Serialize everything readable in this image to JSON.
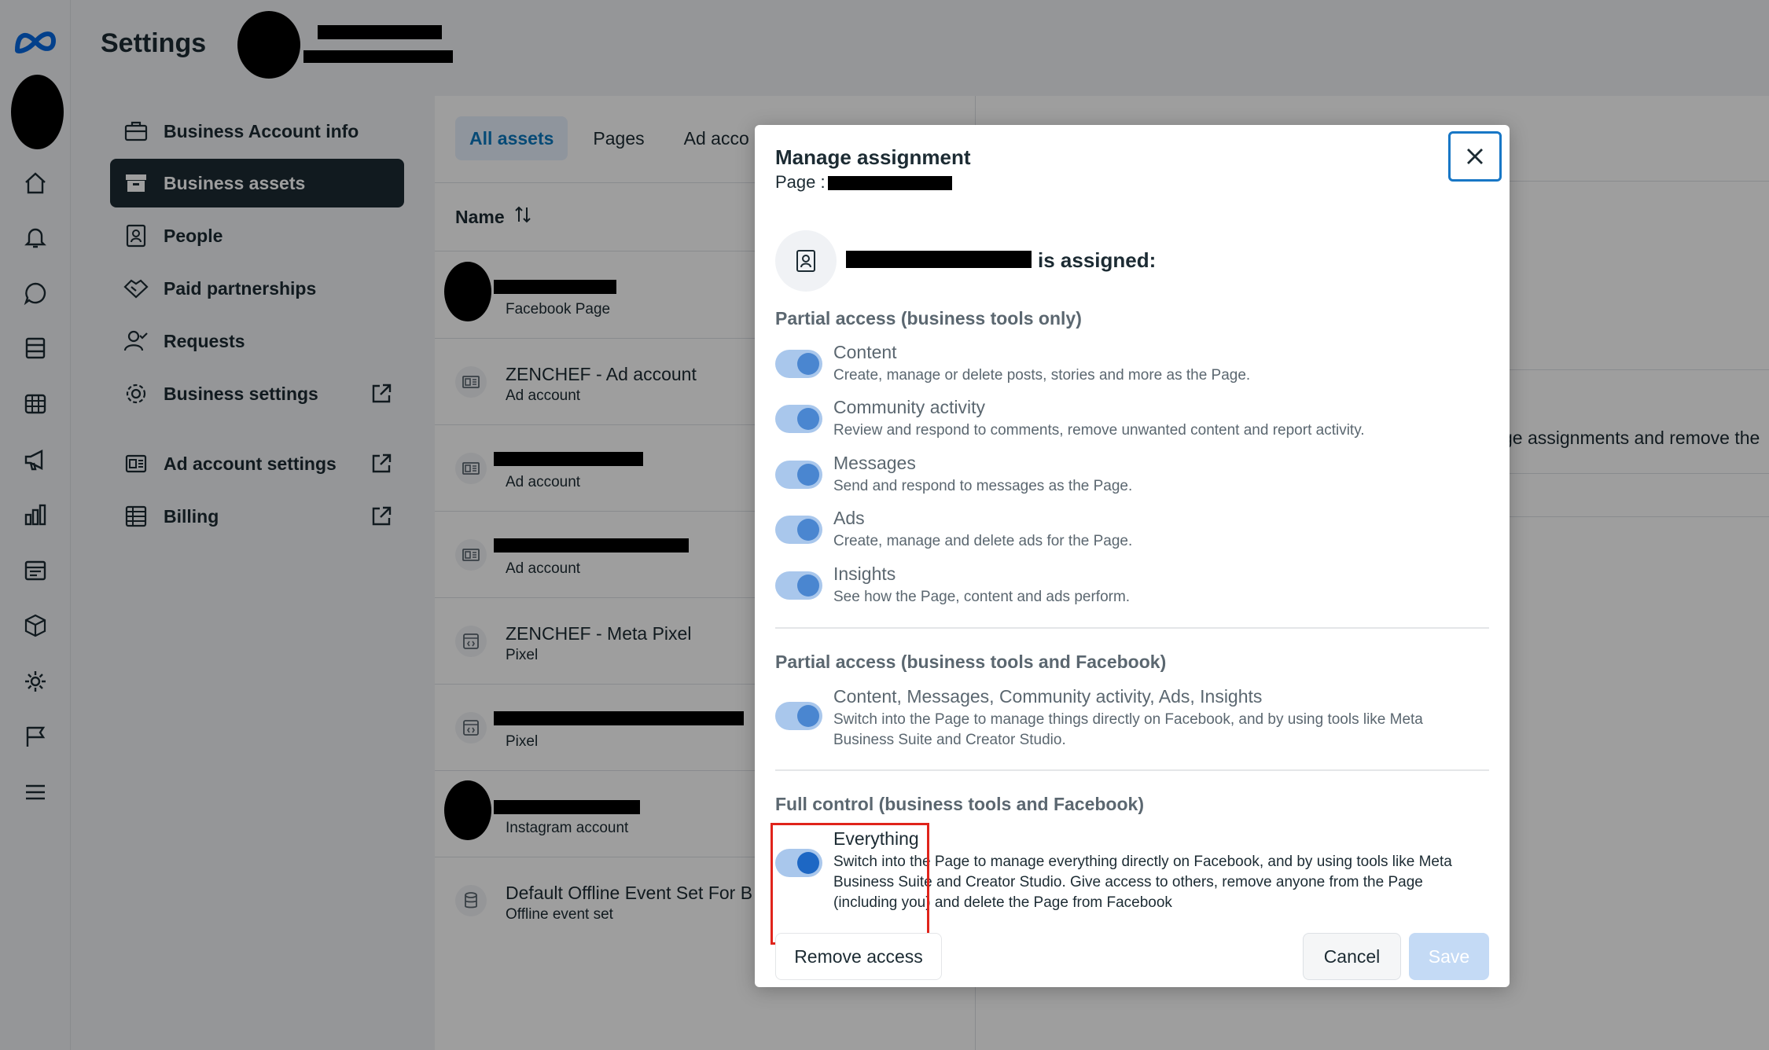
{
  "app": {
    "title": "Settings"
  },
  "rail": {
    "icons": [
      "meta-logo-icon",
      "home-icon",
      "bell-icon",
      "chat-icon",
      "pages-icon",
      "table-icon",
      "megaphone-icon",
      "bar-chart-icon",
      "billing-card-icon",
      "cube-icon",
      "gear-icon",
      "flag-icon",
      "menu-icon"
    ]
  },
  "nav": {
    "items": [
      {
        "label": "Business Account info",
        "icon": "briefcase-icon",
        "external": false
      },
      {
        "label": "Business assets",
        "icon": "archive-icon",
        "external": false,
        "active": true
      },
      {
        "label": "People",
        "icon": "id-badge-icon",
        "external": false
      },
      {
        "label": "Paid partnerships",
        "icon": "handshake-icon",
        "external": false
      },
      {
        "label": "Requests",
        "icon": "person-check-icon",
        "external": false
      },
      {
        "label": "Business settings",
        "icon": "gear-icon",
        "external": true
      },
      {
        "label": "Ad account settings",
        "icon": "ad-account-icon",
        "external": true
      },
      {
        "label": "Billing",
        "icon": "billing-icon",
        "external": true
      }
    ]
  },
  "main": {
    "tabs": [
      "All assets",
      "Pages",
      "Ad acco"
    ],
    "active_tab": "All assets",
    "column_header": "Name",
    "rows": [
      {
        "title": "",
        "subtitle": "Facebook Page",
        "type": "avatar"
      },
      {
        "title": "ZENCHEF - Ad account",
        "subtitle": "Ad account",
        "type": "ad"
      },
      {
        "title": "",
        "subtitle": "Ad account",
        "type": "ad"
      },
      {
        "title": "",
        "subtitle": "Ad account",
        "type": "ad"
      },
      {
        "title": "ZENCHEF - Meta Pixel",
        "subtitle": "Pixel",
        "type": "pixel"
      },
      {
        "title": "",
        "subtitle": "Pixel",
        "type": "pixel"
      },
      {
        "title": "",
        "subtitle": "Instagram account",
        "type": "avatar"
      },
      {
        "title": "Default Offline Event Set For B",
        "subtitle": "Offline event set",
        "type": "offline"
      }
    ]
  },
  "right": {
    "partial_text": "ge assignments and remove the"
  },
  "modal": {
    "title": "Manage assignment",
    "page_label": "Page :",
    "assigned_suffix": "is assigned:",
    "sections": [
      {
        "heading": "Partial access (business tools only)",
        "permissions": [
          {
            "label": "Content",
            "description": "Create, manage or delete posts, stories and more as the Page."
          },
          {
            "label": "Community activity",
            "description": "Review and respond to comments, remove unwanted content and report activity."
          },
          {
            "label": "Messages",
            "description": "Send and respond to messages as the Page."
          },
          {
            "label": "Ads",
            "description": "Create, manage and delete ads for the Page."
          },
          {
            "label": "Insights",
            "description": "See how the Page, content and ads perform."
          }
        ]
      },
      {
        "heading": "Partial access (business tools and Facebook)",
        "permissions": [
          {
            "label": "Content, Messages, Community activity, Ads, Insights",
            "description": "Switch into the Page to manage things directly on Facebook, and by using tools like Meta Business Suite and Creator Studio."
          }
        ]
      },
      {
        "heading": "Full control (business tools and Facebook)",
        "permissions": [
          {
            "label": "Everything",
            "description": "Switch into the Page to manage everything directly on Facebook, and by using tools like Meta Business Suite and Creator Studio. Give access to others, remove anyone from the Page (including you) and delete the Page from Facebook"
          }
        ]
      }
    ],
    "buttons": {
      "remove": "Remove access",
      "cancel": "Cancel",
      "save": "Save"
    }
  },
  "colors": {
    "accent": "#1877c6",
    "highlight": "#e0241b",
    "nav_active": "#1c2b33"
  }
}
